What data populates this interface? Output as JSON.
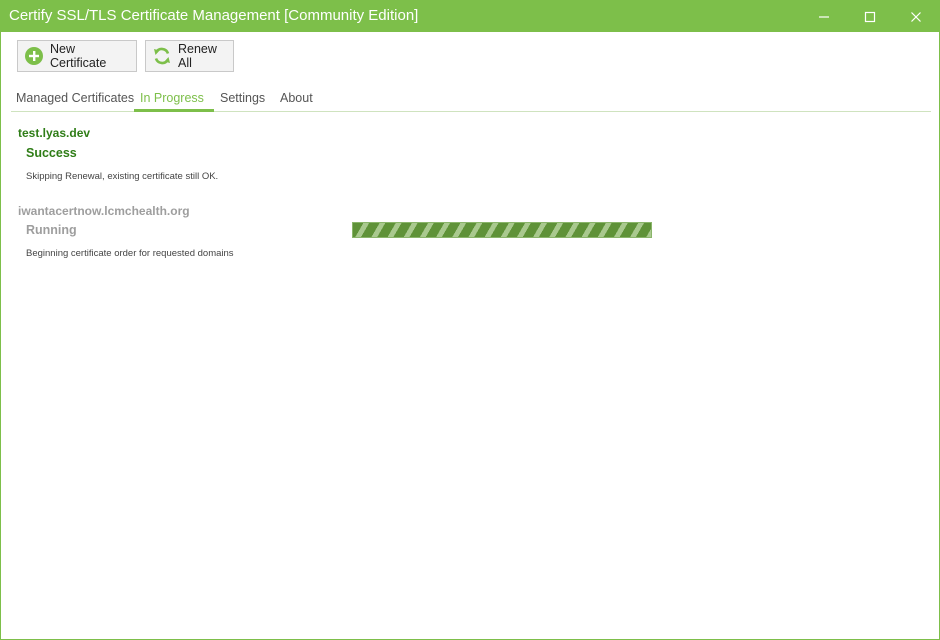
{
  "window": {
    "title": "Certify SSL/TLS Certificate Management [Community Edition]"
  },
  "toolbar": {
    "new_certificate_label": "New Certificate",
    "renew_all_label": "Renew All"
  },
  "tabs": [
    {
      "label": "Managed Certificates",
      "active": false
    },
    {
      "label": "In Progress",
      "active": true
    },
    {
      "label": "Settings",
      "active": false
    },
    {
      "label": "About",
      "active": false
    }
  ],
  "progress_items": [
    {
      "domain": "test.lyas.dev",
      "status": "Success",
      "message": "Skipping Renewal, existing certificate still OK."
    },
    {
      "domain": "iwantacertnow.lcmchealth.org",
      "status": "Running",
      "message": "Beginning certificate order for requested domains",
      "progress_fraction": 1.0
    }
  ],
  "colors": {
    "accent": "#7dbf4a",
    "success": "#2f7d17",
    "pending": "#9e9e9e",
    "progress_bar": "#5f9238"
  },
  "icons": {
    "new_certificate": "plus-circle-icon",
    "renew_all": "refresh-icon",
    "minimize": "minimize-icon",
    "maximize": "maximize-icon",
    "close": "close-icon"
  }
}
